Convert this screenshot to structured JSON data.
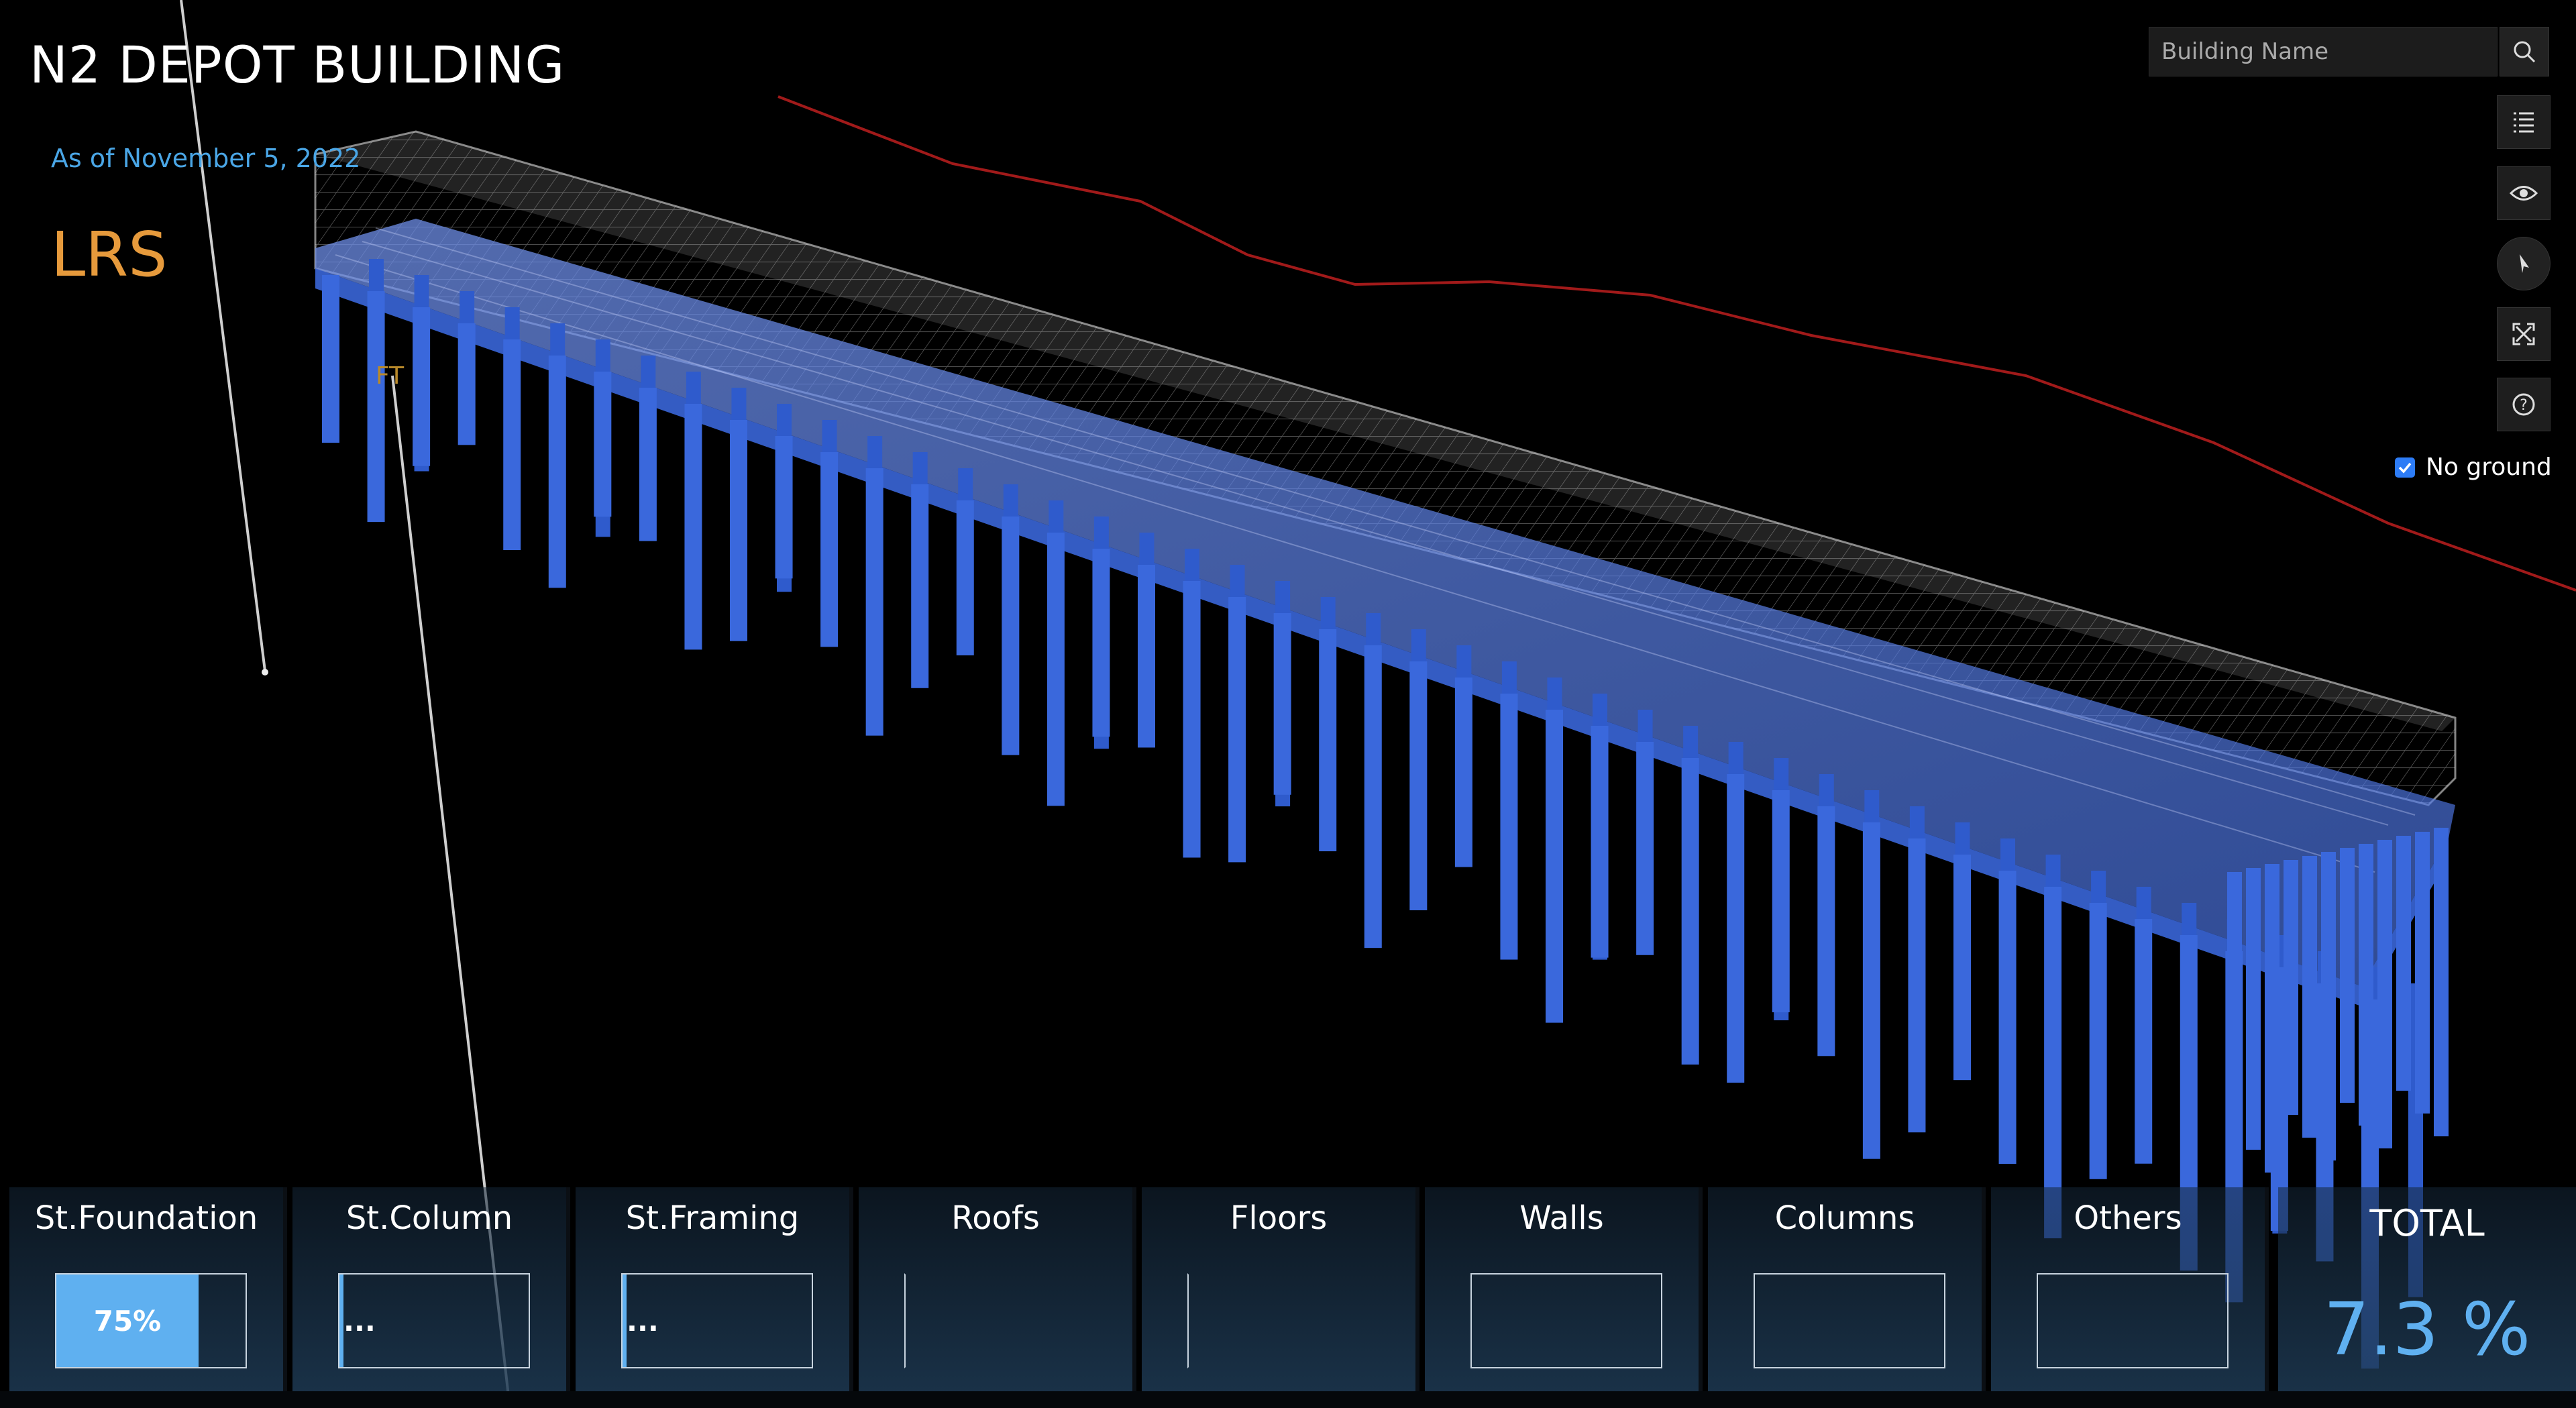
{
  "header": {
    "title": "N2 DEPOT BUILDING",
    "date": "As of November 5, 2022",
    "site_code": "LRS",
    "marker_label": "FT"
  },
  "search": {
    "placeholder": "Building Name"
  },
  "toolbar": {
    "icons": [
      "search-icon",
      "layer-list-icon",
      "eye-icon",
      "compass-icon",
      "fullscreen-icon",
      "help-icon"
    ]
  },
  "ground_toggle": {
    "label": "No ground",
    "checked": true
  },
  "progress": {
    "categories": [
      {
        "label": "St.Foundation",
        "value": 0.75,
        "text": "75%"
      },
      {
        "label": "St.Column",
        "value": 0.01,
        "text": "..."
      },
      {
        "label": "St.Framing",
        "value": 0.01,
        "text": "..."
      },
      {
        "label": "Roofs",
        "value": 0,
        "text": ""
      },
      {
        "label": "Floors",
        "value": 0,
        "text": ""
      },
      {
        "label": "Walls",
        "value": 0,
        "text": ""
      },
      {
        "label": "Columns",
        "value": 0,
        "text": ""
      },
      {
        "label": "Others",
        "value": 0,
        "text": ""
      }
    ],
    "total_label": "TOTAL",
    "total_value": "7.3 %"
  },
  "colors": {
    "accent": "#5fb0f0",
    "site": "#e69a3c",
    "date": "#4aa6e6",
    "structure": "#3d6fe0"
  }
}
